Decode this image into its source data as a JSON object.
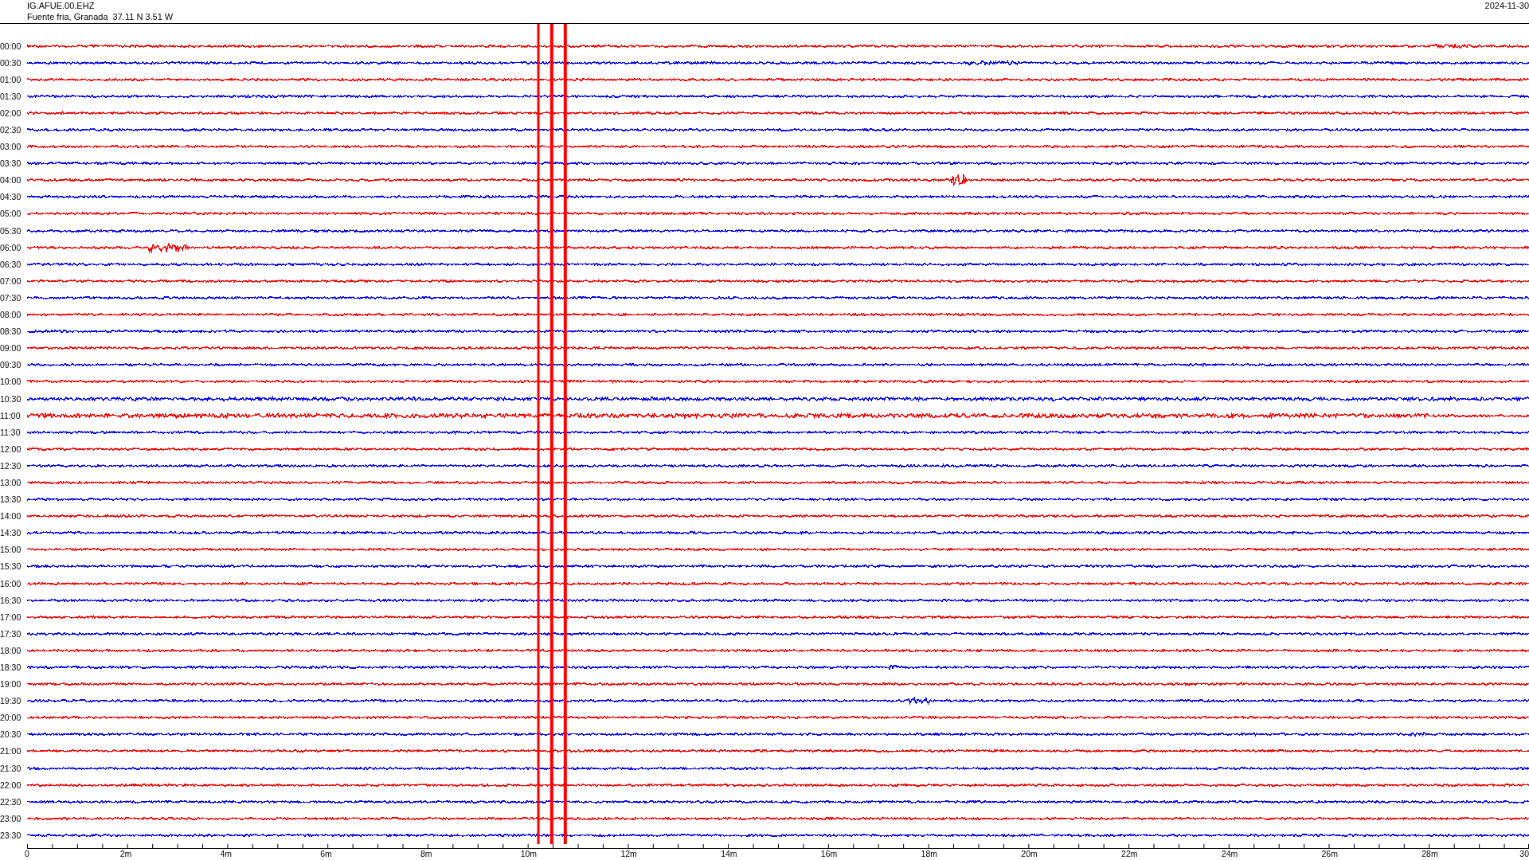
{
  "header": {
    "station": "IG.AFUE.00.EHZ",
    "location": "Fuente fria, Granada  37.11 N 3.51 W",
    "date": "2024-11-30"
  },
  "rows": [
    {
      "label": "00:00",
      "color": "#ff0000"
    },
    {
      "label": "00:30",
      "color": "#0000ff"
    },
    {
      "label": "01:00",
      "color": "#ff0000"
    },
    {
      "label": "01:30",
      "color": "#0000ff"
    },
    {
      "label": "02:00",
      "color": "#ff0000"
    },
    {
      "label": "02:30",
      "color": "#0000ff"
    },
    {
      "label": "03:00",
      "color": "#ff0000"
    },
    {
      "label": "03:30",
      "color": "#0000ff"
    },
    {
      "label": "04:00",
      "color": "#ff0000"
    },
    {
      "label": "04:30",
      "color": "#0000ff"
    },
    {
      "label": "05:00",
      "color": "#ff0000"
    },
    {
      "label": "05:30",
      "color": "#0000ff"
    },
    {
      "label": "06:00",
      "color": "#ff0000"
    },
    {
      "label": "06:30",
      "color": "#0000ff"
    },
    {
      "label": "07:00",
      "color": "#ff0000"
    },
    {
      "label": "07:30",
      "color": "#0000ff"
    },
    {
      "label": "08:00",
      "color": "#ff0000"
    },
    {
      "label": "08:30",
      "color": "#0000ff"
    },
    {
      "label": "09:00",
      "color": "#ff0000"
    },
    {
      "label": "09:30",
      "color": "#0000ff"
    },
    {
      "label": "10:00",
      "color": "#ff0000"
    },
    {
      "label": "10:30",
      "color": "#0000ff"
    },
    {
      "label": "11:00",
      "color": "#ff0000"
    },
    {
      "label": "11:30",
      "color": "#0000ff"
    },
    {
      "label": "12:00",
      "color": "#ff0000"
    },
    {
      "label": "12:30",
      "color": "#0000ff"
    },
    {
      "label": "13:00",
      "color": "#ff0000"
    },
    {
      "label": "13:30",
      "color": "#0000ff"
    },
    {
      "label": "14:00",
      "color": "#ff0000"
    },
    {
      "label": "14:30",
      "color": "#0000ff"
    },
    {
      "label": "15:00",
      "color": "#ff0000"
    },
    {
      "label": "15:30",
      "color": "#0000ff"
    },
    {
      "label": "16:00",
      "color": "#ff0000"
    },
    {
      "label": "16:30",
      "color": "#0000ff"
    },
    {
      "label": "17:00",
      "color": "#ff0000"
    },
    {
      "label": "17:30",
      "color": "#0000ff"
    },
    {
      "label": "18:00",
      "color": "#ff0000"
    },
    {
      "label": "18:30",
      "color": "#0000ff"
    },
    {
      "label": "19:00",
      "color": "#ff0000"
    },
    {
      "label": "19:30",
      "color": "#0000ff"
    },
    {
      "label": "20:00",
      "color": "#ff0000"
    },
    {
      "label": "20:30",
      "color": "#0000ff"
    },
    {
      "label": "21:00",
      "color": "#ff0000"
    },
    {
      "label": "21:30",
      "color": "#0000ff"
    },
    {
      "label": "22:00",
      "color": "#ff0000"
    },
    {
      "label": "22:30",
      "color": "#0000ff"
    },
    {
      "label": "23:00",
      "color": "#ff0000"
    },
    {
      "label": "23:30",
      "color": "#0000ff"
    }
  ],
  "x_axis": {
    "labels": [
      "0",
      "2m",
      "4m",
      "6m",
      "8m",
      "10m",
      "12m",
      "14m",
      "16m",
      "18m",
      "20m",
      "22m",
      "24m",
      "26m",
      "28m",
      "30"
    ]
  }
}
